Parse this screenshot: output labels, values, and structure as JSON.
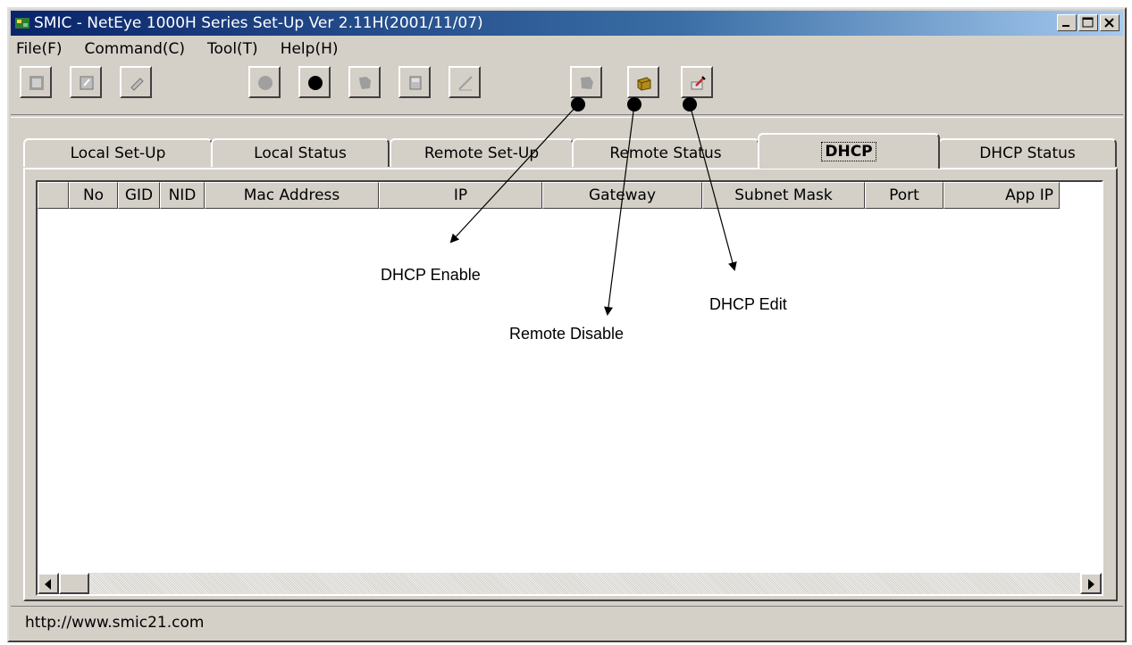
{
  "window": {
    "title": "SMIC - NetEye 1000H Series Set-Up Ver 2.11H(2001/11/07)",
    "controls": [
      "minimize-icon",
      "maximize-icon",
      "close-icon"
    ]
  },
  "menu": [
    "File(F)",
    "Command(C)",
    "Tool(T)",
    "Help(H)"
  ],
  "toolbar": {
    "icons": [
      "network-icon",
      "device-icon",
      "edit-tag-icon",
      "gray-circle-icon",
      "black-circle-icon",
      "puzzle-icon",
      "print-icon",
      "pencil-icon",
      "remote-enable-icon",
      "remote-disable-icon",
      "dhcp-edit-icon"
    ]
  },
  "tabs": [
    "Local Set-Up",
    "Local Status",
    "Remote Set-Up",
    "Remote Status",
    "DHCP",
    "DHCP Status"
  ],
  "active_tab": "DHCP",
  "table": {
    "columns": [
      "",
      "No",
      "GID",
      "NID",
      "Mac Address",
      "IP",
      "Gateway",
      "Subnet Mask",
      "Port",
      "App IP"
    ],
    "rows": []
  },
  "annotations": {
    "dhcp_enable": "DHCP Enable",
    "remote_disable": "Remote Disable",
    "dhcp_edit": "DHCP Edit"
  },
  "status_text": "http://www.smic21.com"
}
